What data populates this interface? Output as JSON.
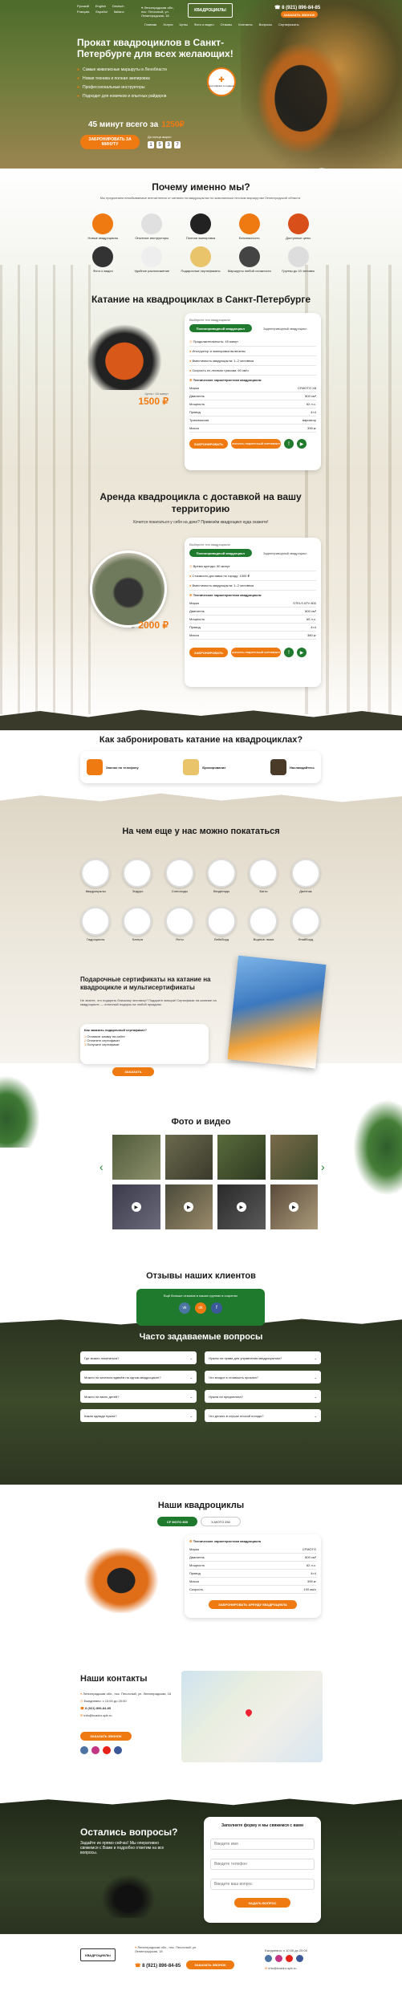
{
  "colors": {
    "accent": "#f07a12",
    "green": "#1f7a2e",
    "dark": "#2c3a22"
  },
  "header": {
    "langs": [
      "Русский",
      "English",
      "Deutsch",
      "Français",
      "Español",
      "Italiano"
    ],
    "address": "Ленинградская обл., пос. Песочный, ул. Ленинградская, 18",
    "logo_text": "КВАДРОЦИКЛЫ",
    "nav": [
      "Главная",
      "Услуги",
      "Цены",
      "Фото и видео",
      "Отзывы",
      "Контакты",
      "Вопросы",
      "Сертификаты"
    ],
    "phone": "8 (921) 896-84-85",
    "callback": "ЗАКАЗАТЬ ЗВОНОК"
  },
  "hero": {
    "title": "Прокат квадроциклов в Санкт-Петербурге для всех желающих!",
    "bullets": [
      "Самые живописные маршруты в Ленобласти",
      "Новая техника и полная экипировка",
      "Профессиональные инструкторы",
      "Подходит для новичков и опытных райдеров"
    ],
    "price_text": "45 минут всего за",
    "price": "1250₽",
    "cta": "ЗАБРОНИРОВАТЬ ЗА МИНУТУ",
    "timer_label": "До конца акции:",
    "timer": [
      "1",
      "5",
      "3",
      "7"
    ],
    "badge": "Сертификат в подарок"
  },
  "why": {
    "title": "Почему именно мы?",
    "subtitle": "Мы предлагаем незабываемые впечатления от катания на квадроциклах по живописным лесным маршрутам Ленинградской области.",
    "items": [
      "Новые квадроциклы",
      "Опытные инструкторы",
      "Полная экипировка",
      "Безопасность",
      "Доступные цены",
      "Фото и видео",
      "Удобное расположение",
      "Подарочные сертификаты",
      "Маршруты любой сложности",
      "Группы до 10 человек"
    ]
  },
  "rental": {
    "title": "Катание на квадроциклах в Санкт-Петербурге",
    "choose": "Выберите тип квадроцикла",
    "tabs": [
      "Полноприводный квадроцикл",
      "Заднеприводный квадроцикл"
    ],
    "features": [
      "Продолжительность: 45 минут",
      "Инструктор и экипировка включены",
      "Вместимость квадроцикла: 1–2 человека",
      "Скорость по лесным трассам: 60 км/ч",
      "Технические характеристики квадроцикла:"
    ],
    "specs": [
      [
        "Марка",
        "CFMOTO X8"
      ],
      [
        "Двигатель",
        "800 см³"
      ],
      [
        "Мощность",
        "62 л.с."
      ],
      [
        "Привод",
        "4×4"
      ],
      [
        "Трансмиссия",
        "вариатор"
      ],
      [
        "Масса",
        "395 кг"
      ]
    ],
    "price_label": "Цена / 45 минут",
    "price": "1500 ₽",
    "btn1": "ЗАБРОНИРОВАТЬ",
    "btn2": "ЗАКАЗАТЬ ПОДАРОЧНЫЙ СЕРТИФИКАТ"
  },
  "delivery": {
    "title": "Аренда квадроцикла с доставкой на вашу территорию",
    "subtitle": "Хочется покататься у себя на даче? Привезём квадроцикл куда скажете!",
    "choose": "Выберите тип квадроцикла",
    "tabs": [
      "Полноприводный квадроцикл",
      "Заднеприводный квадроцикл"
    ],
    "features": [
      "Время аренды: 60 минут",
      "Стоимость доставки по городу: 1000 ₽",
      "Вместимость квадроцикла: 1–2 человека",
      "Технические характеристики квадроцикла:"
    ],
    "specs": [
      [
        "Марка",
        "STELS ATV 800"
      ],
      [
        "Двигатель",
        "800 см³"
      ],
      [
        "Мощность",
        "60 л.с."
      ],
      [
        "Привод",
        "4×4"
      ],
      [
        "Масса",
        "380 кг"
      ]
    ],
    "price_label": "от",
    "price": "2000 ₽",
    "btn1": "ЗАБРОНИРОВАТЬ",
    "btn2": "ЗАКАЗАТЬ ПОДАРОЧНЫЙ СЕРТИФИКАТ"
  },
  "howto": {
    "title": "Как забронировать катание на квадроциклах?",
    "steps": [
      "Звонок по телефону",
      "Бронирование",
      "Наслаждайтесь"
    ]
  },
  "others": {
    "title": "На чем еще у нас можно покататься",
    "row1": [
      "Квадроциклы",
      "Эндуро",
      "Снегоходы",
      "Вездеходы",
      "Багги",
      "Джетпак"
    ],
    "row2": [
      "Гидроциклы",
      "Катера",
      "Яхты",
      "Вейкборд",
      "Водные лыжи",
      "Флайборд"
    ]
  },
  "cert": {
    "title": "Подарочные сертификаты на катание на квадроцикле и мультисертификаты",
    "text": "Не знаете, что подарить близкому человеку? Подарите эмоции! Сертификат на катание на квадроцикле — отличный подарок на любой праздник.",
    "question": "Как заказать подарочный сертификат?",
    "steps": [
      "Оставьте заявку на сайте",
      "Оплатите сертификат",
      "Получите сертификат"
    ],
    "btn": "ЗАКАЗАТЬ"
  },
  "media": {
    "title": "Фото и видео"
  },
  "reviews": {
    "title": "Отзывы наших клиентов",
    "text": "Ещё больше отзывов в наших группах в соцсетях"
  },
  "faq": {
    "title": "Часто задаваемые вопросы",
    "items": [
      "Где можно покататься?",
      "Нужны ли права для управления квадроциклом?",
      "Можно ли кататься вдвоём на одном квадроцикле?",
      "Что входит в стоимость проката?",
      "Можно ли взять детей?",
      "Нужна ли предоплата?",
      "Какая одежда нужна?",
      "Что делать в случае плохой погоды?"
    ]
  },
  "fleet": {
    "title": "Наши квадроциклы",
    "tabs": [
      "CF MOTO 800",
      "X-MOTO 250"
    ],
    "spec_title": "Технические характеристики квадроцикла",
    "specs": [
      [
        "Марка",
        "CFMOTO"
      ],
      [
        "Двигатель",
        "800 см³"
      ],
      [
        "Мощность",
        "62 л.с."
      ],
      [
        "Привод",
        "4×4"
      ],
      [
        "Масса",
        "395 кг"
      ],
      [
        "Скорость",
        "100 км/ч"
      ]
    ],
    "btn": "ЗАБРОНИРОВАТЬ АРЕНДУ КВАДРОЦИКЛА"
  },
  "contacts": {
    "title": "Наши контакты",
    "address": "Ленинградская обл., пос. Песочный, ул. Ленинградская, 18",
    "schedule": "Ежедневно: с 10:00 до 20:00",
    "phone": "8 (921) 896-84-85",
    "email": "info@kvadro-spb.ru",
    "btn": "ЗАКАЗАТЬ ЗВОНОК"
  },
  "questions": {
    "title": "Остались вопросы?",
    "text": "Задайте их прямо сейчас! Мы оперативно свяжемся с Вами и подробно ответим на все вопросы.",
    "form_title": "Заполните форму и мы свяжемся с вами",
    "placeholders": [
      "Введите имя",
      "Введите телефон",
      "Введите ваш вопрос"
    ],
    "btn": "ЗАДАТЬ ВОПРОС"
  },
  "footer": {
    "address": "Ленинградская обл., пос. Песочный, ул. Ленинградская, 18",
    "phone": "8 (921) 896-84-85",
    "btn": "ЗАКАЗАТЬ ЗВОНОК",
    "schedule": "Ежедневно: с 10:00 до 20:00",
    "email": "info@kvadro-spb.ru"
  }
}
